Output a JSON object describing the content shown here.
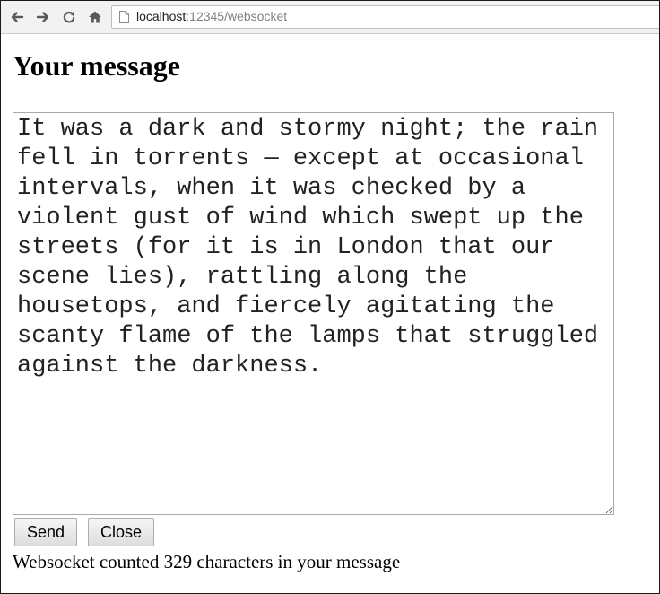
{
  "browser": {
    "url_host": "localhost",
    "url_rest": ":12345/websocket"
  },
  "page": {
    "heading": "Your message",
    "message_text": "It was a dark and stormy night; the rain fell in torrents — except at occasional intervals, when it was checked by a violent gust of wind which swept up the streets (for it is in London that our scene lies), rattling along the housetops, and fiercely agitating the scanty flame of the lamps that struggled against the darkness.",
    "send_label": "Send",
    "close_label": "Close",
    "status": "Websocket counted 329 characters in your message"
  },
  "icons": {
    "back": "back-arrow-icon",
    "forward": "forward-arrow-icon",
    "reload": "reload-icon",
    "home": "home-icon",
    "page": "page-icon"
  }
}
